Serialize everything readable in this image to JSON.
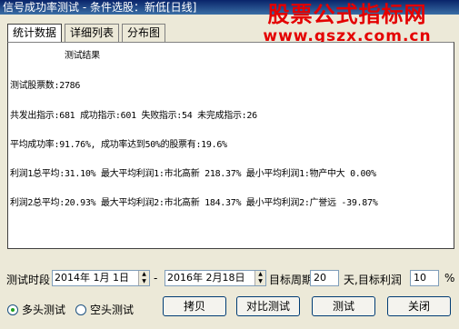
{
  "window": {
    "title": "信号成功率测试 - 条件选股：新低[日线]"
  },
  "watermark": {
    "line1": "股票公式指标网",
    "line2": "www.gszx.com.cn"
  },
  "tabs": [
    {
      "label": "统计数据",
      "active": true
    },
    {
      "label": "详细列表",
      "active": false
    },
    {
      "label": "分布图",
      "active": false
    }
  ],
  "results": {
    "heading": "测试结果",
    "total": "测试股票数:2786",
    "signals": "共发出指示:681 成功指示:601 失败指示:54 未完成指示:26",
    "success": "平均成功率:91.76%, 成功率达到50%的股票有:19.6%",
    "profit1": "利润1总平均:31.10% 最大平均利润1:市北高新 218.37% 最小平均利润1:物产中大 0.00%",
    "profit2": "利润2总平均:20.93% 最大平均利润2:市北高新 184.37% 最小平均利润2:广誉远 -39.87%"
  },
  "controls": {
    "period_label": "测试时段",
    "start_date": "2014年 1月 1日",
    "dash": "-",
    "end_date": "2016年 2月18日",
    "target_period_label": "目标周期",
    "target_period_value": "20",
    "target_profit_label": "天,目标利润",
    "target_profit_value": "10",
    "percent": "%"
  },
  "options": {
    "long_test": {
      "label": "多头测试",
      "selected": true
    },
    "short_test": {
      "label": "空头测试",
      "selected": false
    }
  },
  "buttons": {
    "copy": "拷贝",
    "compare": "对比测试",
    "test": "测试",
    "close": "关闭"
  }
}
